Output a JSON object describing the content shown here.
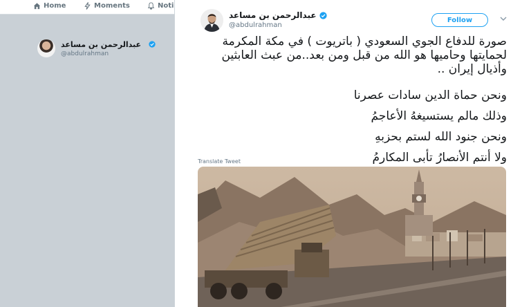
{
  "nav": {
    "home": "Home",
    "moments": "Moments",
    "notifications": "Noti"
  },
  "background_profile": {
    "name": "عبدالرحمن بن مساعد",
    "handle": "@abdulrahman"
  },
  "tweet": {
    "author_name": "عبدالرحمن بن مساعد",
    "handle": "@abdulrahman",
    "follow_label": "Follow",
    "lines": [
      "صورة للدفاع الجوي السعودي ( باتريوت ) في مكة المكرمة لحمايتها وحاميها هو الله من قبل ومن بعد..من عبث العابثين وأذيال إيران ..",
      "ونحن حماة الدين سادات عصرنا",
      "وذلك مالم يستسيغهُ الأعاجمُ",
      "ونحن جنود الله لستم بحزبهِ",
      "ولا أنتم الأنصارُ تأبى المكارمُ"
    ],
    "translate_label": "Translate Tweet"
  },
  "colors": {
    "accent": "#1da1f2",
    "text": "#14171a",
    "muted": "#657786"
  },
  "icons": [
    "home-icon",
    "lightning-icon",
    "bell-icon",
    "verified-icon",
    "chevron-down-icon"
  ]
}
